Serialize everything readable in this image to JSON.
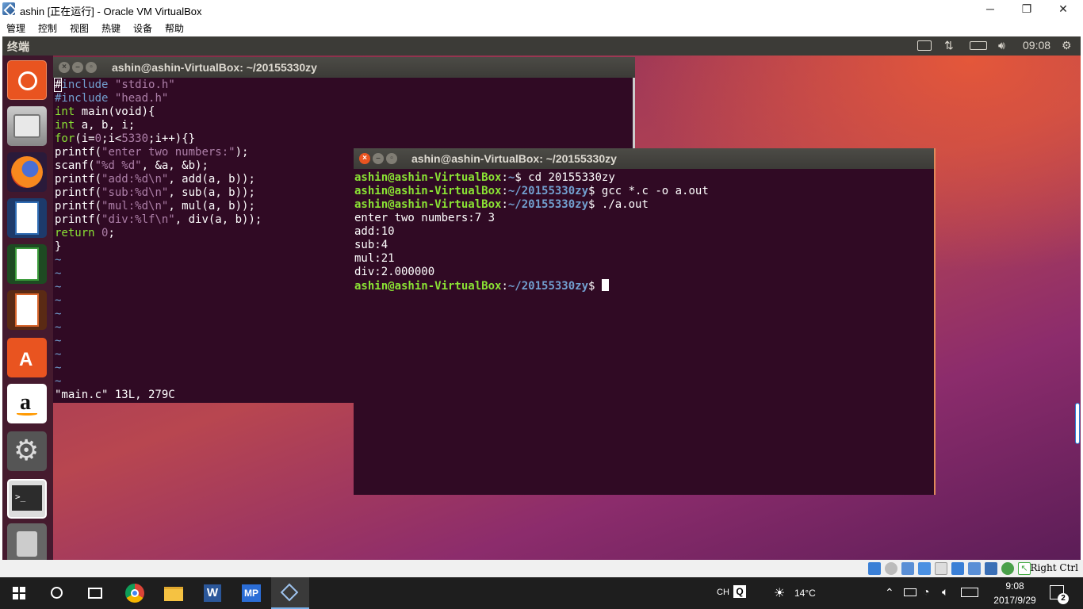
{
  "host_window": {
    "title": "ashin [正在运行] - Oracle VM VirtualBox",
    "minimize_label": "─",
    "maximize_label": "❐",
    "close_label": "✕",
    "menu": [
      "管理",
      "控制",
      "视图",
      "热键",
      "设备",
      "帮助"
    ]
  },
  "guest_panel": {
    "app_title": "终端",
    "clock": "09:08",
    "icons": [
      "keyboard-icon",
      "network-icon",
      "battery-icon",
      "volume-icon",
      "settings-icon"
    ]
  },
  "launcher": {
    "items": [
      "ubuntu-dash",
      "files",
      "firefox",
      "libreoffice-writer",
      "libreoffice-calc",
      "libreoffice-impress",
      "ubuntu-software",
      "amazon",
      "system-settings",
      "terminal",
      "trash"
    ]
  },
  "terminal_vim": {
    "title": "ashin@ashin-VirtualBox: ~/20155330zy",
    "status_line": "\"main.c\" 13L, 279C",
    "tilde": "~",
    "code": {
      "l1_hash": "#",
      "l1_include": "include",
      "l1_file": "\"stdio.h\"",
      "l2_include": "#include",
      "l2_file": "\"head.h\"",
      "l3_int": "int",
      "l3_rest": " main(void){",
      "l4_int": "int",
      "l4_rest": " a, b, i;",
      "l5_for": "for",
      "l5_a": "(i=",
      "l5_n0": "0",
      "l5_b": ";i<",
      "l5_n1": "5330",
      "l5_c": ";i++){}",
      "l6_a": "printf(",
      "l6_s": "\"enter two numbers:\"",
      "l6_b": ");",
      "l7_a": "scanf(",
      "l7_s": "\"%d %d\"",
      "l7_b": ", &a, &b);",
      "l8_a": "printf(",
      "l8_s": "\"add:%d\\n\"",
      "l8_b": ", add(a, b));",
      "l9_a": "printf(",
      "l9_s": "\"sub:%d\\n\"",
      "l9_b": ", sub(a, b));",
      "l10_a": "printf(",
      "l10_s": "\"mul:%d\\n\"",
      "l10_b": ", mul(a, b));",
      "l11_a": "printf(",
      "l11_s": "\"div:%lf\\n\"",
      "l11_b": ", div(a, b));",
      "l12_return": "return",
      "l12_sp": " ",
      "l12_n": "0",
      "l12_end": ";",
      "l13": "}"
    }
  },
  "terminal_run": {
    "title": "ashin@ashin-VirtualBox: ~/20155330zy",
    "prompt_user": "ashin@ashin-VirtualBox",
    "colon": ":",
    "path_home": "~",
    "path_dir": "~/20155330zy",
    "cmd1": "$ cd 20155330zy",
    "cmd2": "$ gcc *.c -o a.out",
    "cmd3": "$ ./a.out",
    "prompt_end": "$ ",
    "out1": "enter two numbers:7 3",
    "out2": "add:10",
    "out3": "sub:4",
    "out4": "mul:21",
    "out5": "div:2.000000"
  },
  "host_statusbar": {
    "hostkey": "Right Ctrl"
  },
  "taskbar": {
    "apps": [
      "start",
      "search",
      "task-view",
      "chrome",
      "file-explorer",
      "word",
      "mp",
      "virtualbox"
    ],
    "word_label": "W",
    "mp_label": "MP",
    "ime": "CH",
    "ime_q": "Q",
    "weather": "14°C",
    "time": "9:08",
    "date": "2017/9/29",
    "notifications": "2"
  }
}
